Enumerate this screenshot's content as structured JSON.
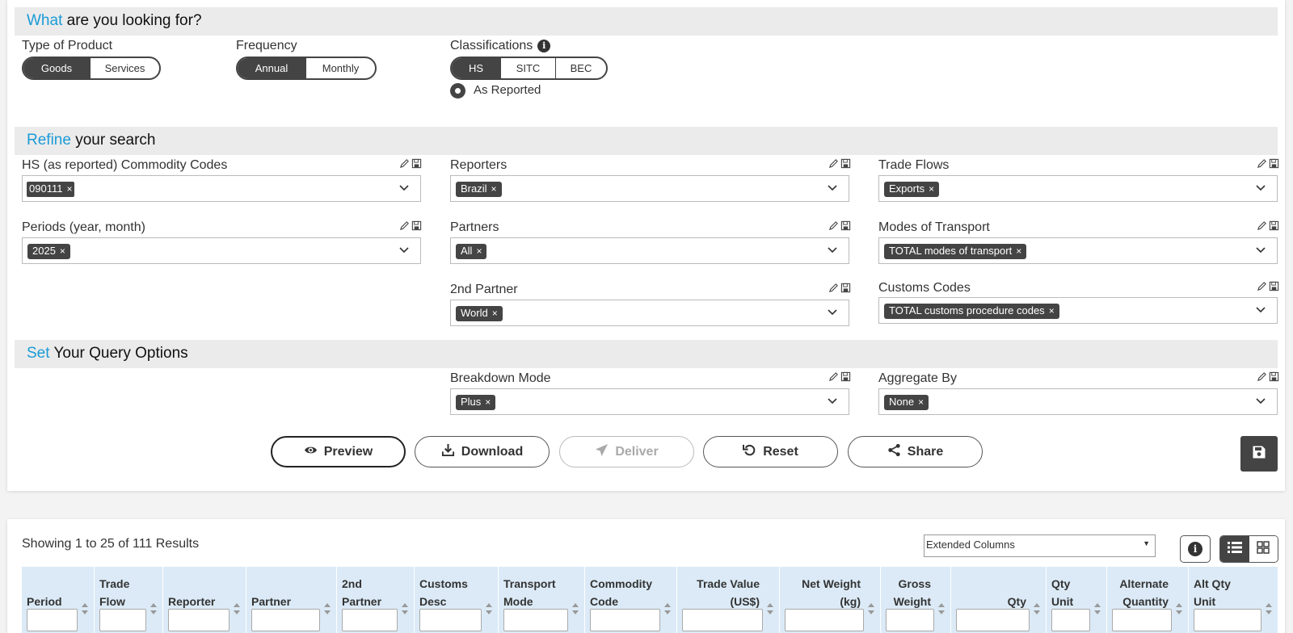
{
  "what": {
    "accent": "What",
    "rest": " are you looking for?"
  },
  "type_of_product": {
    "label": "Type of Product",
    "options": [
      "Goods",
      "Services"
    ]
  },
  "frequency": {
    "label": "Frequency",
    "options": [
      "Annual",
      "Monthly"
    ]
  },
  "classifications": {
    "label": "Classifications",
    "options": [
      "HS",
      "SITC",
      "BEC"
    ],
    "radio_label": "As Reported",
    "info_glyph": "i"
  },
  "refine": {
    "accent": "Refine",
    "rest": " your search"
  },
  "filters": {
    "commodity": {
      "label": "HS (as reported) Commodity Codes",
      "chip": "090111"
    },
    "reporters": {
      "label": "Reporters",
      "chip": "Brazil"
    },
    "trade_flows": {
      "label": "Trade Flows",
      "chip": "Exports"
    },
    "periods": {
      "label": "Periods (year, month)",
      "chip": "2025"
    },
    "partners": {
      "label": "Partners",
      "chip": "All"
    },
    "transport": {
      "label": "Modes of Transport",
      "chip": "TOTAL modes of transport"
    },
    "partner2": {
      "label": "2nd Partner",
      "chip": "World"
    },
    "customs": {
      "label": "Customs Codes",
      "chip": "TOTAL customs procedure codes"
    },
    "breakdown": {
      "label": "Breakdown Mode",
      "chip": "Plus"
    },
    "aggregate": {
      "label": "Aggregate By",
      "chip": "None"
    },
    "chip_remove": "×"
  },
  "query": {
    "accent": "Set",
    "rest": " Your Query Options"
  },
  "actions": {
    "preview": "Preview",
    "download": "Download",
    "deliver": "Deliver",
    "reset": "Reset",
    "share": "Share"
  },
  "results": {
    "summary": "Showing 1 to 25 of 111 Results",
    "columns_select": "Extended Columns",
    "info_glyph": "i"
  },
  "table": {
    "headers": [
      [
        "Period"
      ],
      [
        "Trade",
        "Flow"
      ],
      [
        "Reporter"
      ],
      [
        "Partner"
      ],
      [
        "2nd",
        "Partner"
      ],
      [
        "Customs",
        "Desc"
      ],
      [
        "Transport",
        "Mode"
      ],
      [
        "Commodity",
        "Code"
      ],
      [
        "Trade Value",
        "(US$)"
      ],
      [
        "Net Weight",
        "(kg)"
      ],
      [
        "Gross",
        "Weight"
      ],
      [
        "Qty"
      ],
      [
        "Qty",
        "Unit"
      ],
      [
        "Alternate",
        "Quantity"
      ],
      [
        "Alt Qty",
        "Unit"
      ]
    ]
  },
  "colors": {
    "accent": "#1a9bd7",
    "dark": "#444444",
    "band": "#ebebeb",
    "table_header": "#dbeaf6"
  }
}
